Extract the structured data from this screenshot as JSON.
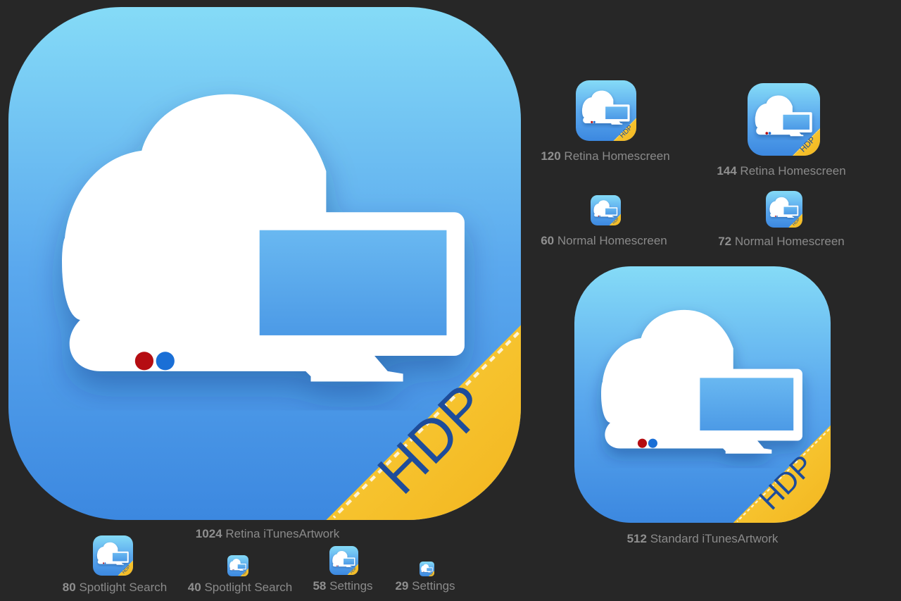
{
  "colors": {
    "background": "#272727",
    "icon_gradient_top": "#85dbf7",
    "icon_gradient_bottom": "#3c88e0",
    "ribbon_yellow": "#f7c52b",
    "ribbon_text": "#1e4c9a",
    "caption_text": "#8a8a8a"
  },
  "ribbon_label": "HDP",
  "icons": [
    {
      "id": "1024",
      "size": "1024",
      "label": "Retina iTunesArtwork"
    },
    {
      "id": "512",
      "size": "512",
      "label": "Standard iTunesArtwork"
    },
    {
      "id": "120",
      "size": "120",
      "label": "Retina Homescreen"
    },
    {
      "id": "144",
      "size": "144",
      "label": "Retina Homescreen"
    },
    {
      "id": "60",
      "size": "60",
      "label": "Normal Homescreen"
    },
    {
      "id": "72",
      "size": "72",
      "label": "Normal Homescreen"
    },
    {
      "id": "80",
      "size": "80",
      "label": "Spotlight Search"
    },
    {
      "id": "40",
      "size": "40",
      "label": "Spotlight Search"
    },
    {
      "id": "58",
      "size": "58",
      "label": "Settings"
    },
    {
      "id": "29",
      "size": "29",
      "label": "Settings"
    }
  ]
}
